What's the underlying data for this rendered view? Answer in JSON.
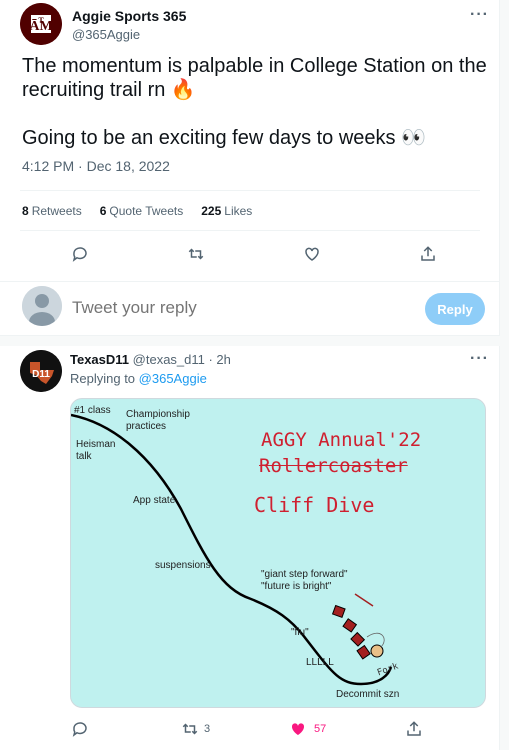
{
  "main": {
    "author_name": "Aggie Sports 365",
    "author_handle": "@365Aggie",
    "text": "The momentum is palpable in College Station on the recruiting trail rn 🔥\n\nGoing to be an exciting few days to weeks 👀",
    "timestamp": "4:12 PM · Dec 18, 2022",
    "stats": [
      {
        "count": "8",
        "label": "Retweets"
      },
      {
        "count": "6",
        "label": "Quote Tweets"
      },
      {
        "count": "225",
        "label": "Likes"
      }
    ],
    "more": "···"
  },
  "reply_box": {
    "placeholder": "Tweet your reply",
    "button": "Reply"
  },
  "reply": {
    "author_name": "TexasD11",
    "author_handle": "@texas_d11 · 2h",
    "replying_prefix": "Replying to",
    "replying_to": "@365Aggie",
    "retweets": "3",
    "likes": "57",
    "more": "···",
    "avatar_text": "D11"
  },
  "image": {
    "labels": {
      "l1": "#1 class",
      "l2": "Championship\npractices",
      "l3": "Heisman\ntalk",
      "l4": "App state",
      "l5": "suspensions",
      "l6": "\"giant step forward\"\n\"future is bright\"",
      "l7": "\"flu\"",
      "l8": "LLLLL",
      "l9": "Decommit szn"
    },
    "hand_title1": "AGGY Annual'22",
    "hand_title2": "Rollercoaster",
    "hand_title3": "Cliff Dive",
    "fork": "Fork"
  },
  "colors": {
    "accent": "#1d9bf0",
    "like": "#f91880",
    "image_bg": "#bff1ef",
    "maroon": "#500000"
  }
}
